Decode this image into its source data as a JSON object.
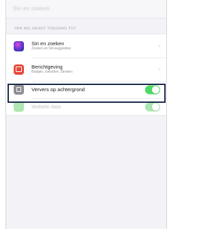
{
  "nav": {
    "title": "Siri en zoeken"
  },
  "section": {
    "header": "Van Wil Heart toegang tot"
  },
  "rows": [
    {
      "icon": "siri-icon",
      "title": "Siri en zoeken",
      "subtitle": "Zoeken en Siri-suggesties",
      "accessory": "chevron"
    },
    {
      "icon": "notification-icon",
      "title": "Berichtgeving",
      "subtitle": "Badges, Geluiden, Stroken",
      "accessory": "chevron"
    },
    {
      "icon": "background-refresh-icon",
      "title": "Ververs op achtergrond",
      "accessory": "toggle",
      "toggle_on": true
    },
    {
      "icon": "cellular-data-icon",
      "title": "Mobiele data",
      "accessory": "toggle",
      "toggle_on": true
    }
  ],
  "chevron_glyph": "›",
  "colors": {
    "toggle_on": "#4cd964",
    "highlight_border": "#1c2b4a",
    "notification_icon": "#e8483a"
  }
}
